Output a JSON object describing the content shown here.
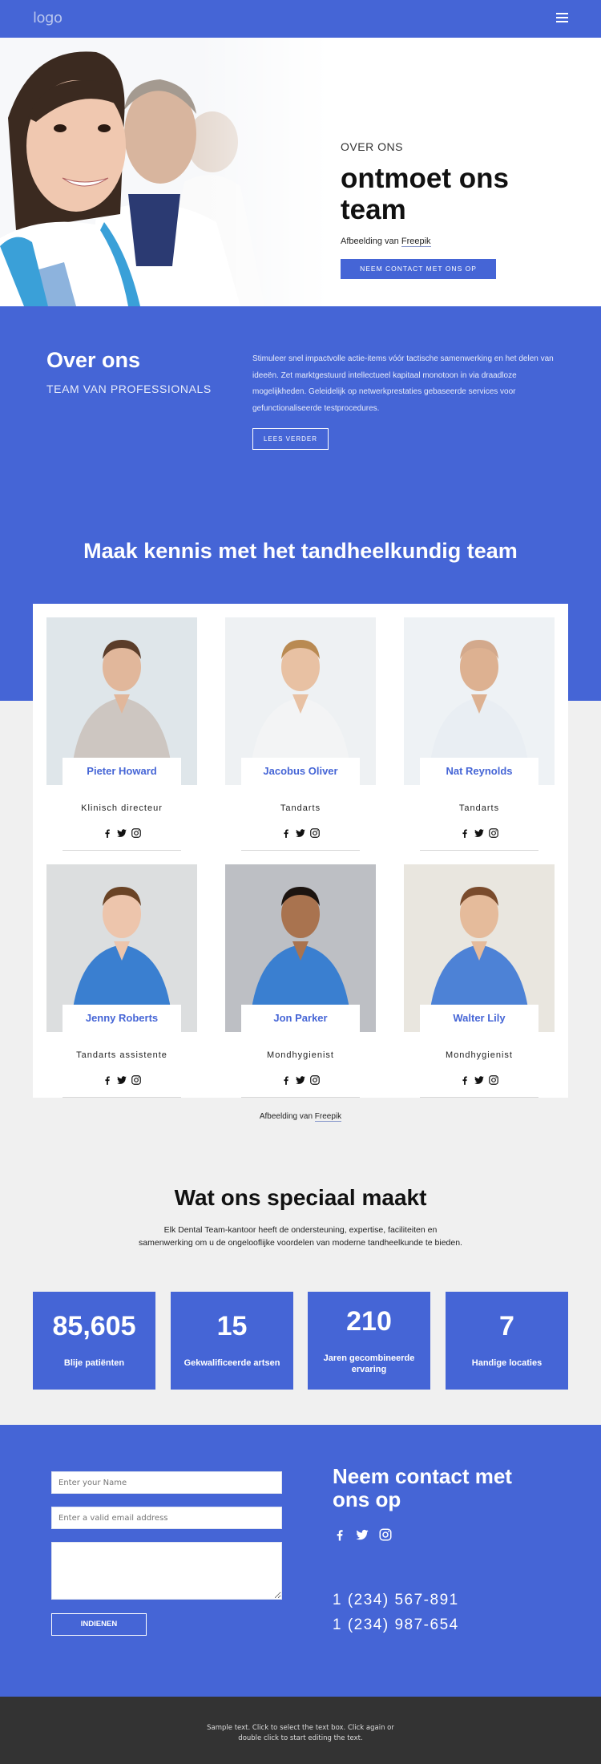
{
  "header": {
    "logo": "logo",
    "menu_icon": "hamburger-menu-icon"
  },
  "hero": {
    "eyebrow": "OVER ONS",
    "title": "ontmoet ons team",
    "credit_prefix": "Afbeelding van ",
    "credit_link": "Freepik",
    "cta": "NEEM CONTACT MET ONS OP"
  },
  "about": {
    "title": "Over ons",
    "subtitle": "TEAM VAN PROFESSIONALS",
    "text": "Stimuleer snel impactvolle actie-items vóór tactische samenwerking en het delen van ideeën. Zet marktgestuurd intellectueel kapitaal monotoon in via draadloze mogelijkheden. Geleidelijk op netwerkprestaties gebaseerde services voor gefunctionaliseerde testprocedures.",
    "button": "LEES VERDER"
  },
  "team": {
    "heading": "Maak kennis met het tandheelkundig team",
    "members": [
      {
        "name": "Pieter Howard",
        "role": "Klinisch directeur"
      },
      {
        "name": "Jacobus Oliver",
        "role": "Tandarts"
      },
      {
        "name": "Nat Reynolds",
        "role": "Tandarts"
      },
      {
        "name": "Jenny Roberts",
        "role": "Tandarts assistente"
      },
      {
        "name": "Jon Parker",
        "role": "Mondhygienist"
      },
      {
        "name": "Walter Lily",
        "role": "Mondhygienist"
      }
    ],
    "social_icons": [
      "facebook-icon",
      "twitter-icon",
      "instagram-icon"
    ],
    "credit_prefix": "Afbeelding van ",
    "credit_link": "Freepik"
  },
  "special": {
    "title": "Wat ons speciaal maakt",
    "text": "Elk Dental Team-kantoor heeft de ondersteuning, expertise, faciliteiten en samenwerking om u de ongelooflijke voordelen van moderne tandheelkunde te bieden.",
    "stats": [
      {
        "value": "85,605",
        "label": "Blije patiënten"
      },
      {
        "value": "15",
        "label": "Gekwalificeerde artsen"
      },
      {
        "value": "210",
        "label": "Jaren gecombineerde ervaring"
      },
      {
        "value": "7",
        "label": "Handige locaties"
      }
    ]
  },
  "contact": {
    "name_placeholder": "Enter your Name",
    "email_placeholder": "Enter a valid email address",
    "message_placeholder": "",
    "submit": "INDIENEN",
    "title": "Neem contact met ons op",
    "phones": [
      "1 (234) 567-891",
      "1 (234) 987-654"
    ]
  },
  "footer": {
    "text": "Sample text. Click to select the text box. Click again or double click to start editing the text."
  },
  "colors": {
    "brand_blue": "#4565d6",
    "page_bg": "#f0f0f0",
    "footer_bg": "#333333"
  }
}
